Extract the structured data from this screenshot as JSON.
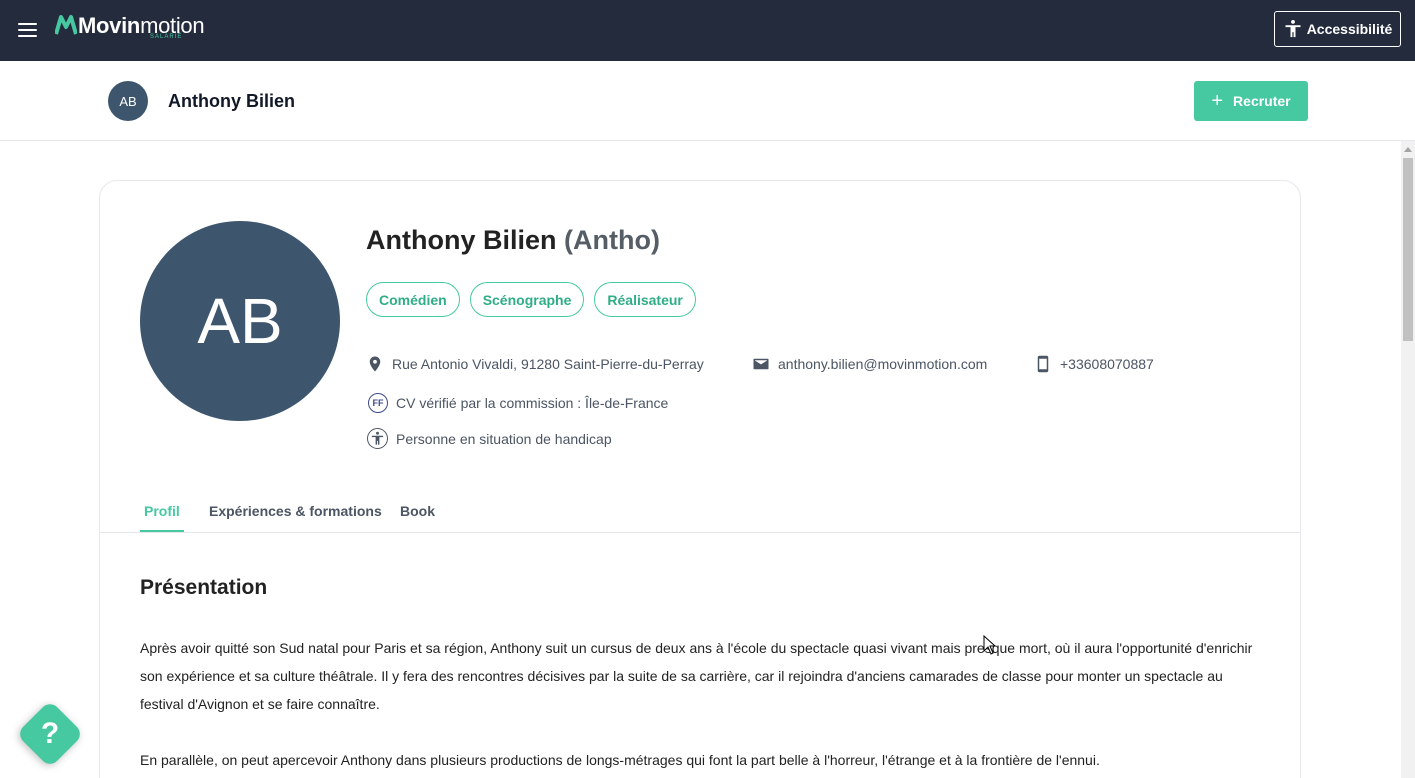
{
  "topbar": {
    "logo_bold": "Movin",
    "logo_light": "motion",
    "logo_sub": "SALARIÉ",
    "accessibility_label": "Accessibilité"
  },
  "subheader": {
    "avatar_initials": "AB",
    "name": "Anthony Bilien",
    "recruit_label": "Recruter"
  },
  "profile": {
    "avatar_initials": "AB",
    "full_name": "Anthony Bilien",
    "nickname": "(Antho)",
    "tags": [
      "Comédien",
      "Scénographe",
      "Réalisateur"
    ],
    "address": "Rue Antonio Vivaldi, 91280 Saint-Pierre-du-Perray",
    "email": "anthony.bilien@movinmotion.com",
    "phone": "+33608070887",
    "cv_badge": "FF",
    "cv_verified": "CV vérifié par la commission : Île-de-France",
    "handicap": "Personne en situation de handicap"
  },
  "tabs": [
    "Profil",
    "Expériences & formations",
    "Book"
  ],
  "content": {
    "section_title": "Présentation",
    "paragraph_1": "Après avoir quitté son Sud natal pour Paris et sa région, Anthony suit un cursus de deux ans à l'école du spectacle quasi vivant mais presque mort, où il aura l'opportunité d'enrichir son expérience et sa culture théâtrale. Il y fera des rencontres décisives par la suite de sa carrière, car il rejoindra d'anciens camarades de classe pour monter un spectacle au festival d'Avignon et se faire connaître.",
    "paragraph_2": "En parallèle, on peut apercevoir Anthony dans plusieurs productions de longs-métrages qui font la part belle à l'horreur, l'étrange et à la frontière de l'ennui."
  },
  "help": {
    "label": "?"
  },
  "colors": {
    "topbar": "#232b3d",
    "accent": "#46c9a0",
    "avatar": "#3d566e"
  }
}
